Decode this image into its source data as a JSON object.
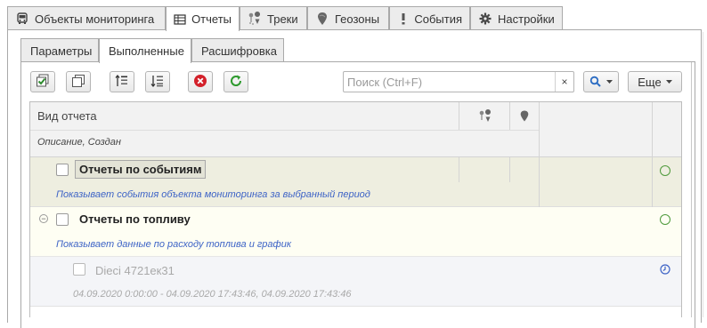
{
  "top_tabs": [
    {
      "label": "Объекты мониторинга",
      "icon": "bus-icon"
    },
    {
      "label": "Отчеты",
      "icon": "table-icon",
      "active": true
    },
    {
      "label": "Треки",
      "icon": "track-icon"
    },
    {
      "label": "Геозоны",
      "icon": "geozone-icon"
    },
    {
      "label": "События",
      "icon": "exclamation-icon"
    },
    {
      "label": "Настройки",
      "icon": "gear-icon"
    }
  ],
  "inner_tabs": [
    {
      "label": "Параметры"
    },
    {
      "label": "Выполненные",
      "active": true
    },
    {
      "label": "Расшифровка"
    }
  ],
  "toolbar": {
    "search_placeholder": "Поиск (Ctrl+F)",
    "clear_label": "×",
    "more_label": "Еще"
  },
  "grid": {
    "header": {
      "col1": "Вид отчета",
      "col1_sub": "Описание, Создан"
    },
    "rows": [
      {
        "title": "Отчеты по событиям",
        "desc": "Показывает события объекта мониторинга за выбранный период",
        "selected": true
      },
      {
        "title": "Отчеты по топливу",
        "desc": "Показывает данные по расходу топлива и график",
        "expanded": true
      }
    ],
    "child": {
      "title": "Dieci 4721ек31",
      "desc": "04.09.2020 0:00:00 - 04.09.2020 17:43:46, 04.09.2020 17:43:46"
    }
  },
  "colors": {
    "selected_row": "#eeeee0",
    "expanded_row": "#fefef3",
    "child_row": "#f4f5f8",
    "desc_blue": "#3d63c6",
    "status_green": "#4e9a3b"
  }
}
